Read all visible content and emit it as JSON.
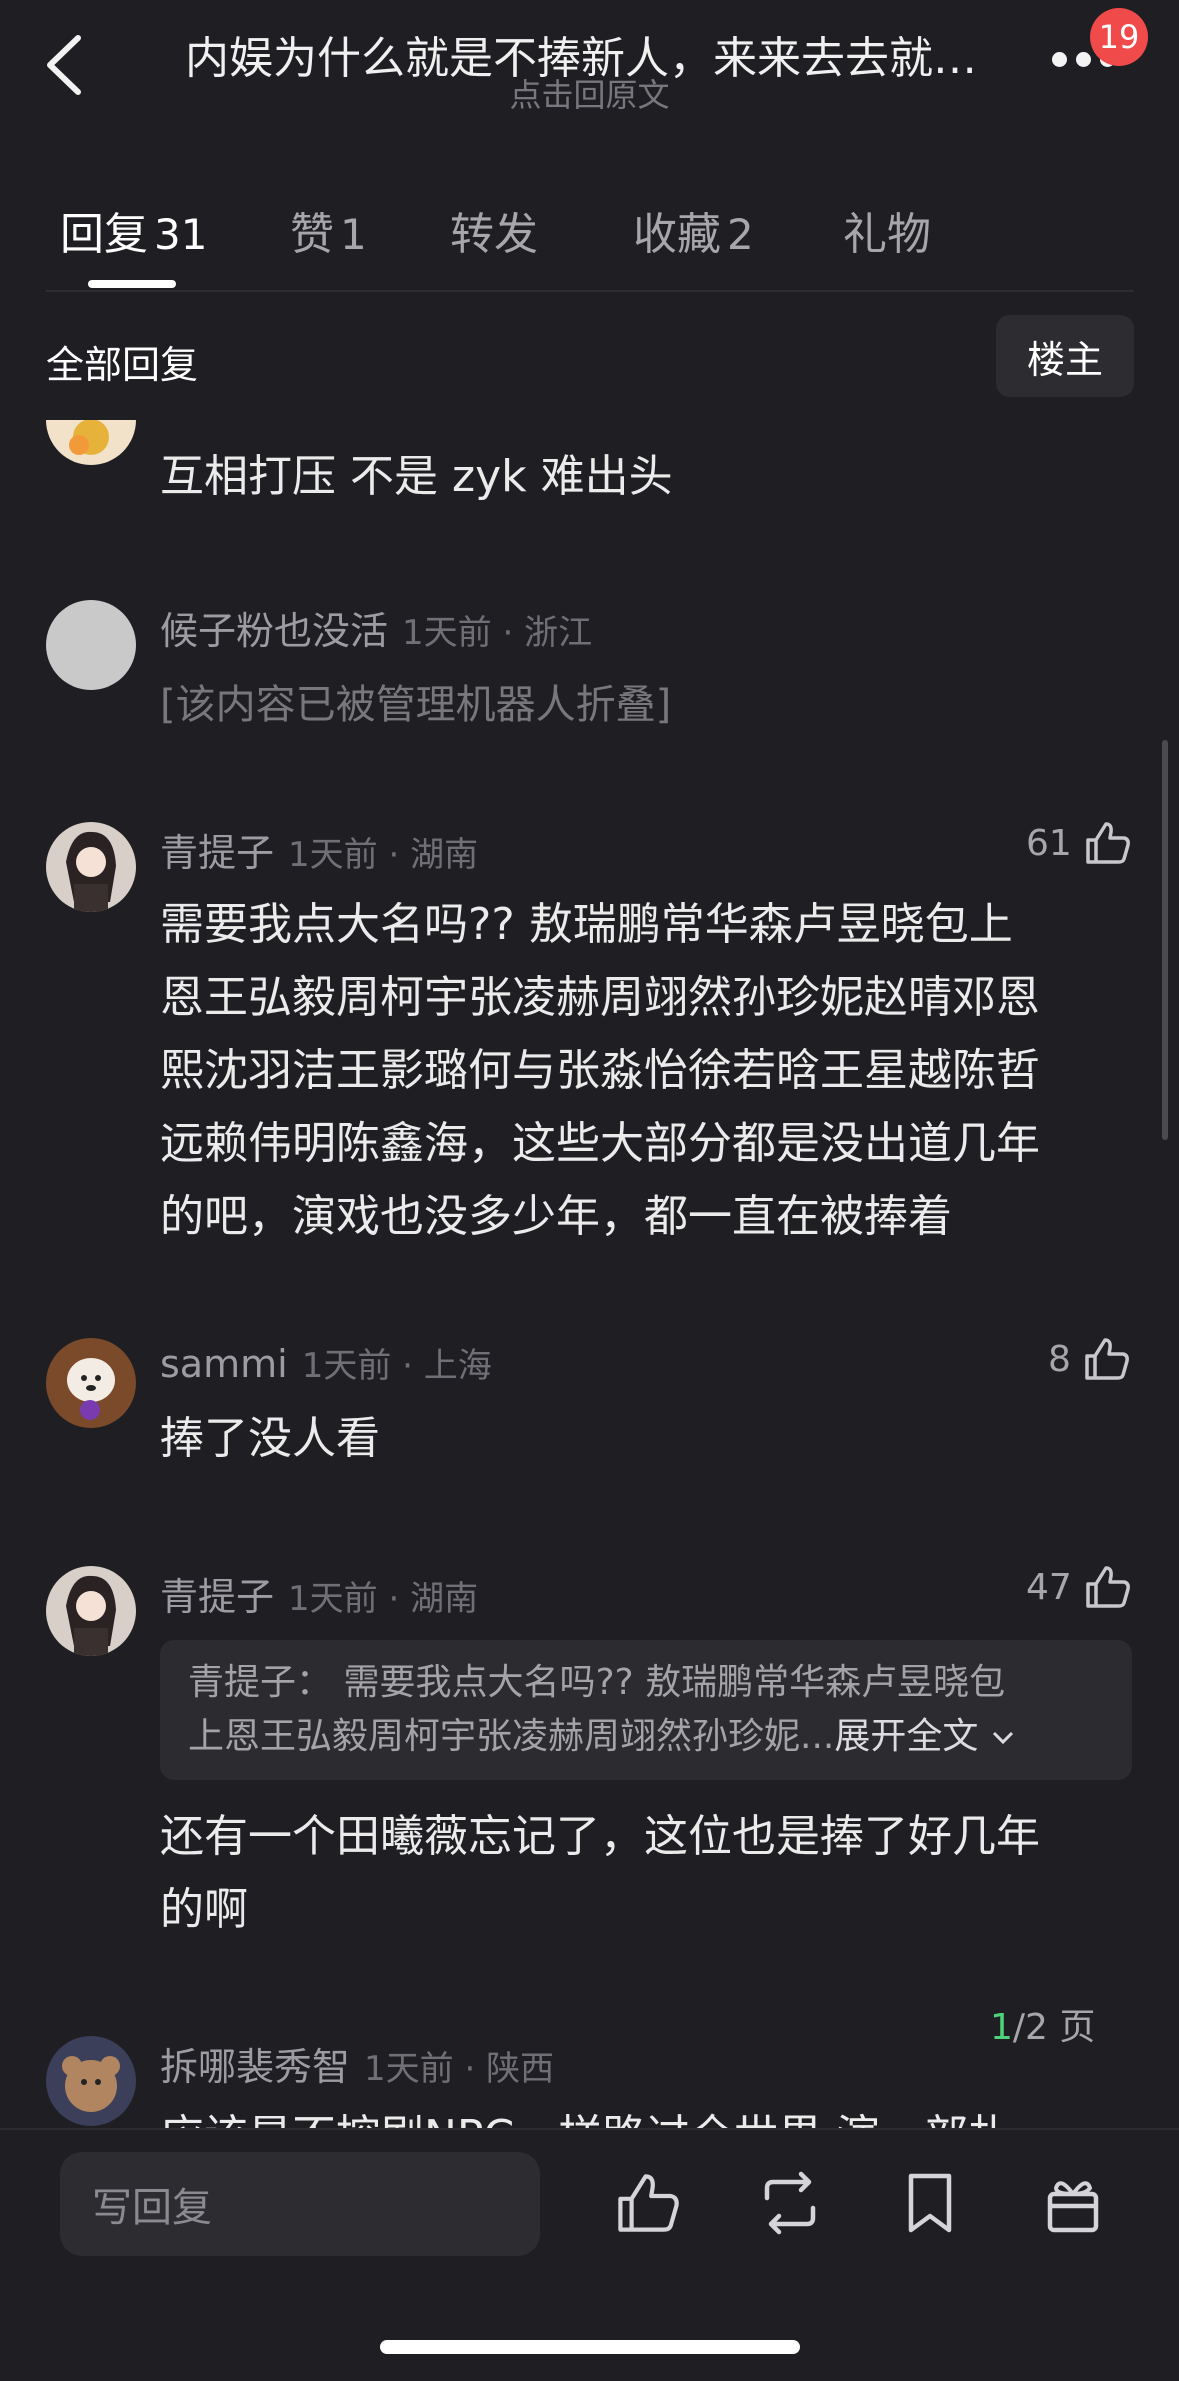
{
  "header": {
    "title": "内娱为什么就是不捧新人，来来去去就…",
    "subtitle": "点击回原文",
    "notification_count": "19"
  },
  "tabs": [
    {
      "label": "回复",
      "count": "31"
    },
    {
      "label": "赞",
      "count": "1"
    },
    {
      "label": "转发",
      "count": ""
    },
    {
      "label": "收藏",
      "count": "2"
    },
    {
      "label": "礼物",
      "count": ""
    }
  ],
  "filter": {
    "all_replies": "全部回复",
    "op_only": "楼主"
  },
  "comments": [
    {
      "content": "互相打压 不是 zyk 难出头"
    },
    {
      "name": "候子粉也没活",
      "meta": "1天前 · 浙江",
      "content": "[该内容已被管理机器人折叠]"
    },
    {
      "name": "青提子",
      "meta": "1天前 · 湖南",
      "likes": "61",
      "lines": [
        "需要我点大名吗??  敖瑞鹏常华森卢昱晓包上",
        "恩王弘毅周柯宇张凌赫周翊然孙珍妮赵晴邓恩",
        "熙沈羽洁王影璐何与张淼怡徐若晗王星越陈哲",
        "远赖伟明陈鑫海，这些大部分都是没出道几年",
        "的吧，演戏也没多少年，都一直在被捧着"
      ]
    },
    {
      "name": "sammi",
      "meta": "1天前 · 上海",
      "likes": "8",
      "content": "捧了没人看"
    },
    {
      "name": "青提子",
      "meta": "1天前 · 湖南",
      "likes": "47",
      "quote_line1": "青提子：  需要我点大名吗??  敖瑞鹏常华森卢昱晓包",
      "quote_line2": "上恩王弘毅周柯宇张凌赫周翊然孙珍妮...",
      "quote_expand": "展开全文",
      "lines": [
        "还有一个田曦薇忘记了，这位也是捧了好几年",
        "的啊"
      ]
    },
    {
      "name": "拆哪裴秀智",
      "meta": "1天前 · 陕西",
      "content": "应该是不控剧NPC一样路过全世界 演一部扎"
    }
  ],
  "pager": {
    "current": "1",
    "rest": "/2 页"
  },
  "bottom_bar": {
    "reply_placeholder": "写回复",
    "icons": [
      "like-icon",
      "repost-icon",
      "bookmark-icon",
      "gift-icon"
    ]
  },
  "colors": {
    "background": "#1f1f23",
    "badge": "#f04a4a",
    "pager_current": "#4fd37a"
  }
}
